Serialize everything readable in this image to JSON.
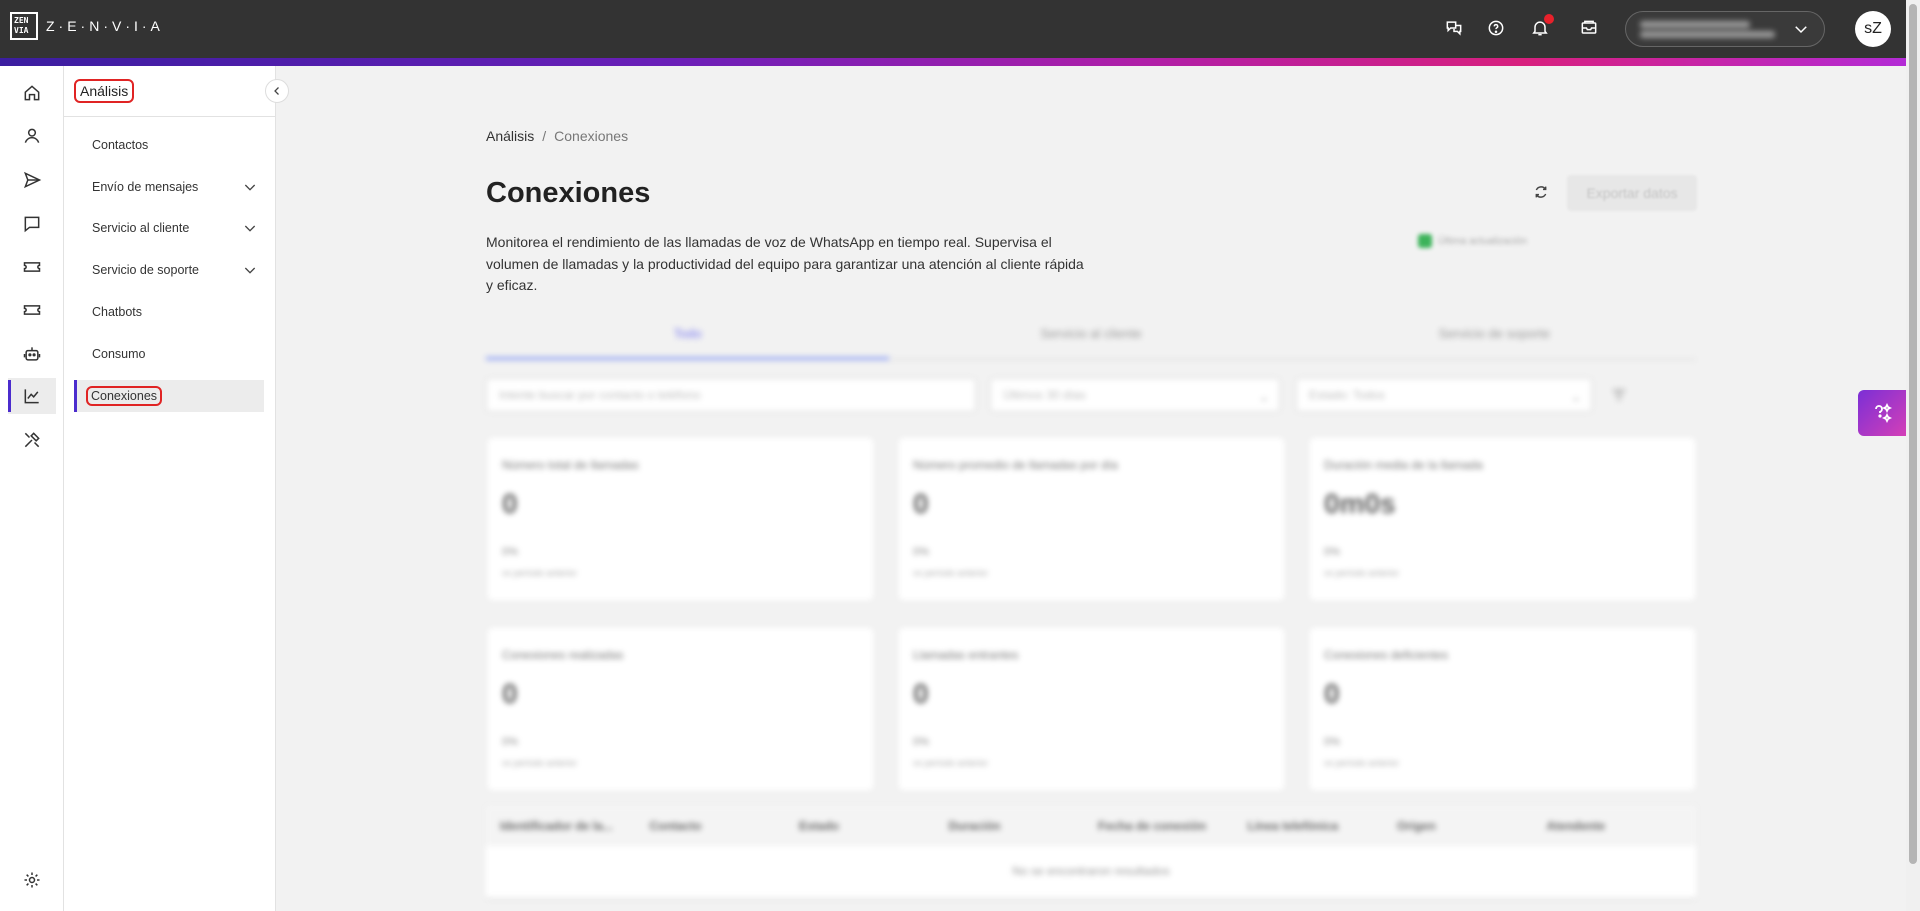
{
  "brand": {
    "logo_mark": "ZEN VIA",
    "logo_text": "Z·E·N·V·I·A"
  },
  "header": {
    "icons": [
      "translate-chat-icon",
      "help-icon",
      "bell-icon",
      "inbox-tray-icon"
    ],
    "account_line1": "Nome conta XYZ",
    "account_line2": "ID organização",
    "avatar_initials": "sZ"
  },
  "rail": {
    "items": [
      "home-icon",
      "user-icon",
      "send-icon",
      "chat-icon",
      "ticket-icon",
      "ticket-alt-icon",
      "robot-icon",
      "analytics-icon",
      "tools-icon"
    ],
    "settings": "gear-icon"
  },
  "submenu": {
    "title": "Análisis",
    "items": [
      {
        "label": "Contactos"
      },
      {
        "label": "Envío de mensajes"
      },
      {
        "label": "Servicio al cliente"
      },
      {
        "label": "Servicio de soporte"
      },
      {
        "label": "Chatbots"
      },
      {
        "label": "Consumo"
      },
      {
        "label": "Conexiones"
      }
    ]
  },
  "breadcrumb": {
    "parent": "Análisis",
    "separator": "/",
    "current": "Conexiones"
  },
  "page": {
    "title": "Conexiones",
    "description": "Monitorea el rendimiento de las llamadas de voz de WhatsApp en tiempo real. Supervisa el volumen de llamadas y la productividad del equipo para garantizar una atención al cliente rápida y eficaz.",
    "export_label": "Exportar datos",
    "updated_label": "Última actualización"
  },
  "tabs": [
    {
      "label": "Todo"
    },
    {
      "label": "Servicio al cliente"
    },
    {
      "label": "Servicio de soporte"
    }
  ],
  "filters": {
    "search_placeholder": "Intente buscar por contacto o teléfono",
    "period": "Últimos 30 días",
    "status": "Estado: Todos"
  },
  "cards": [
    {
      "label": "Número total de llamadas",
      "value": "0",
      "delta": "0%",
      "period": "vs período anterior"
    },
    {
      "label": "Número promedio de llamadas por día",
      "value": "0",
      "delta": "0%",
      "period": "vs período anterior"
    },
    {
      "label": "Duración media de la llamada",
      "value": "0m0s",
      "delta": "0%",
      "period": "vs período anterior"
    },
    {
      "label": "Conexiones realizadas",
      "value": "0",
      "delta": "0%",
      "period": "vs período anterior"
    },
    {
      "label": "Llamadas entrantes",
      "value": "0",
      "delta": "0%",
      "period": "vs período anterior"
    },
    {
      "label": "Conexiones deficientes",
      "value": "0",
      "delta": "0%",
      "period": "vs período anterior"
    }
  ],
  "table": {
    "columns": [
      "Identificador de la...",
      "Contacto",
      "Estado",
      "Duración",
      "Fecha de conexión",
      "Línea telefónica",
      "Origen",
      "Atendente"
    ],
    "empty_message": "No se encontraron resultados"
  }
}
